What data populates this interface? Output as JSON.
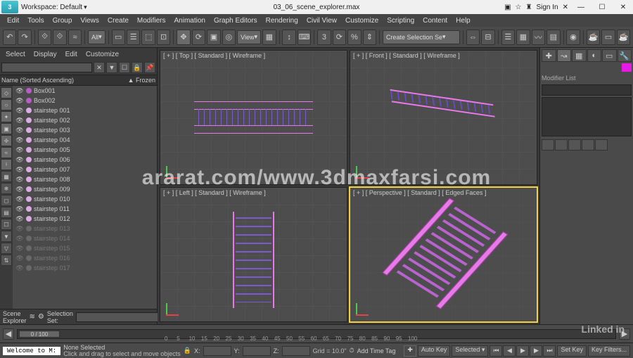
{
  "title": {
    "workspace": "Workspace: Default",
    "filename": "03_06_scene_explorer.max",
    "signIn": "Sign In"
  },
  "menus": [
    "Edit",
    "Tools",
    "Group",
    "Views",
    "Create",
    "Modifiers",
    "Animation",
    "Graph Editors",
    "Rendering",
    "Civil View",
    "Customize",
    "Scripting",
    "Content",
    "Help"
  ],
  "toolbar": {
    "allLabel": "All",
    "viewLabel": "View",
    "selSetLabel": "Create Selection Se"
  },
  "sceneExplorer": {
    "menus": [
      "Select",
      "Display",
      "Edit",
      "Customize"
    ],
    "headerName": "Name (Sorted Ascending)",
    "headerFrozen": "▲ Frozen",
    "items": [
      {
        "name": "Box001",
        "color": "#b85cc7",
        "dim": false
      },
      {
        "name": "Box002",
        "color": "#b85cc7",
        "dim": false
      },
      {
        "name": "stairstep 001",
        "color": "#dbabe6",
        "dim": false
      },
      {
        "name": "stairstep 002",
        "color": "#dbabe6",
        "dim": false
      },
      {
        "name": "stairstep 003",
        "color": "#dbabe6",
        "dim": false
      },
      {
        "name": "stairstep 004",
        "color": "#dbabe6",
        "dim": false
      },
      {
        "name": "stairstep 005",
        "color": "#dbabe6",
        "dim": false
      },
      {
        "name": "stairstep 006",
        "color": "#dbabe6",
        "dim": false
      },
      {
        "name": "stairstep 007",
        "color": "#dbabe6",
        "dim": false
      },
      {
        "name": "stairstep 008",
        "color": "#dbabe6",
        "dim": false
      },
      {
        "name": "stairstep 009",
        "color": "#dbabe6",
        "dim": false
      },
      {
        "name": "stairstep 010",
        "color": "#dbabe6",
        "dim": false
      },
      {
        "name": "stairstep 011",
        "color": "#dbabe6",
        "dim": false
      },
      {
        "name": "stairstep 012",
        "color": "#dbabe6",
        "dim": false
      },
      {
        "name": "stairstep 013",
        "color": "#888",
        "dim": true
      },
      {
        "name": "stairstep 014",
        "color": "#888",
        "dim": true
      },
      {
        "name": "stairstep 015",
        "color": "#888",
        "dim": true
      },
      {
        "name": "stairstep 016",
        "color": "#888",
        "dim": true
      },
      {
        "name": "stairstep 017",
        "color": "#888",
        "dim": true
      }
    ],
    "footerLabel": "Scene Explorer",
    "selSetLabel": "Selection Set:"
  },
  "viewports": {
    "top": "[ + ] [ Top ] [ Standard ] [ Wireframe ]",
    "front": "[ + ] [ Front ] [ Standard ] [ Wireframe ]",
    "left": "[ + ] [ Left ] [ Standard ] [ Wireframe ]",
    "persp": "[ + ] [ Perspective ] [ Standard ] [ Edged Faces ]"
  },
  "cmdPanel": {
    "modifierList": "Modifier List"
  },
  "timeline": {
    "frame": "0 / 100",
    "ticks": [
      "0",
      "5",
      "10",
      "15",
      "20",
      "25",
      "30",
      "35",
      "40",
      "45",
      "50",
      "55",
      "60",
      "65",
      "70",
      "75",
      "80",
      "85",
      "90",
      "95",
      "100"
    ]
  },
  "status": {
    "welcome": "Welcome to M:",
    "selected": "None Selected",
    "hint": "Click and drag to select and move objects",
    "x": "X:",
    "y": "Y:",
    "z": "Z:",
    "grid": "Grid = 10.0\"",
    "addTag": "Add Time Tag",
    "autoKey": "Auto Key",
    "selectedKey": "Selected",
    "setKey": "Set Key",
    "keyFilters": "Key Filters..."
  },
  "watermark": "ararat.com/www.3dmaxfarsi.com",
  "linkedin": "Linked in"
}
